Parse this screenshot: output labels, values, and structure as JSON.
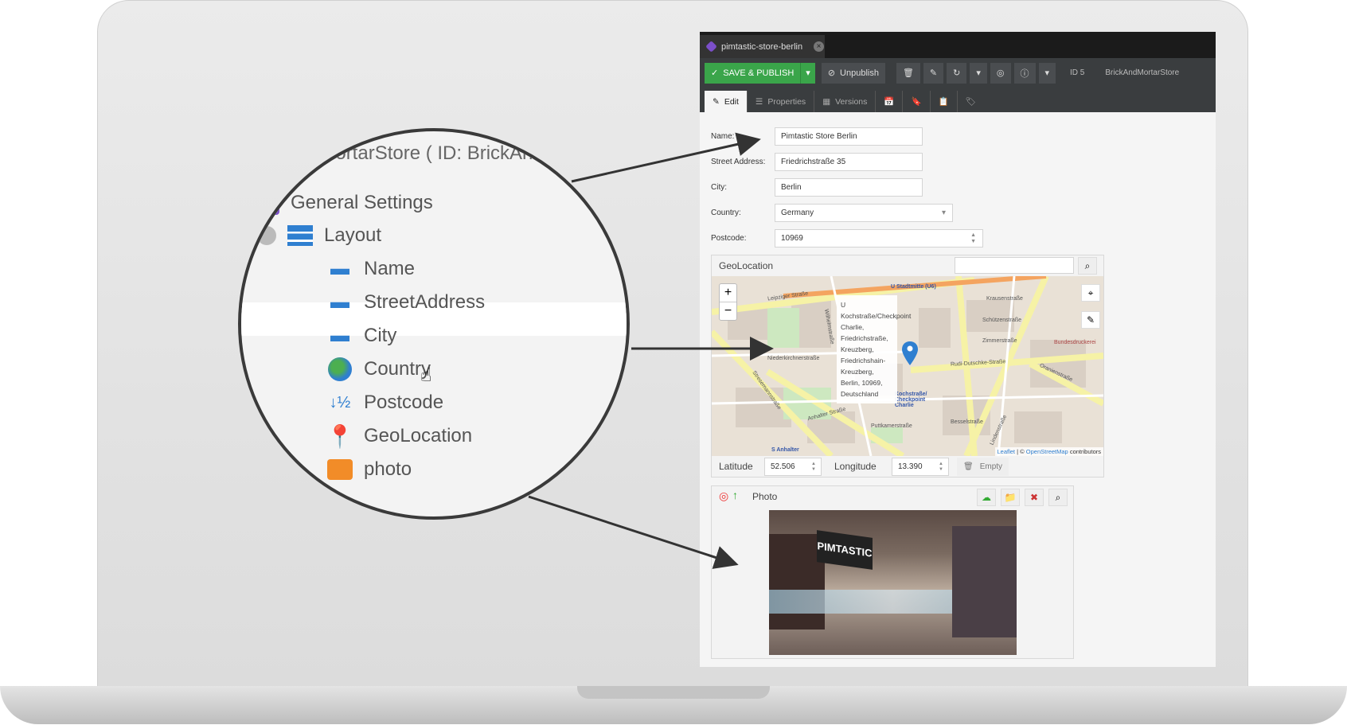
{
  "tab": {
    "title": "pimtastic-store-berlin"
  },
  "toolbar": {
    "save_publish": "SAVE & PUBLISH",
    "unpublish": "Unpublish",
    "id": "ID 5",
    "class_name": "BrickAndMortarStore"
  },
  "subtabs": [
    "Edit",
    "Properties",
    "Versions"
  ],
  "form": {
    "name": {
      "label": "Name:",
      "value": "Pimtastic Store Berlin"
    },
    "street": {
      "label": "Street Address:",
      "value": "Friedrichstraße 35"
    },
    "city": {
      "label": "City:",
      "value": "Berlin"
    },
    "country": {
      "label": "Country:",
      "value": "Germany"
    },
    "postcode": {
      "label": "Postcode:",
      "value": "10969"
    }
  },
  "geo": {
    "title": "GeoLocation",
    "latitude_label": "Latitude",
    "latitude": "52.506",
    "longitude_label": "Longitude",
    "longitude": "13.390",
    "empty": "Empty",
    "popup": [
      "U",
      "Kochstraße/Checkpoint",
      "Charlie,",
      "Friedrichstraße,",
      "Kreuzberg,",
      "Friedrichshain-",
      "Kreuzberg,",
      "Berlin, 10969,",
      "Deutschland"
    ],
    "attribution_leaflet": "Leaflet",
    "attribution_osm": "OpenStreetMap",
    "attribution_rest": "contributors",
    "streets": [
      "Leipziger Straße",
      "U Stadtmitte (U6)",
      "Krausenstraße",
      "Schützenstraße",
      "Zimmerstraße",
      "Rudi-Dutschke-Straße",
      "Oranienstraße",
      "Niederkirchnerstraße",
      "Stresemannstraße",
      "Anhalter Straße",
      "Wilhelmstraße",
      "Kochstraße/ Checkpoint Charlie",
      "Bundesdruckerei",
      "S Anhalter",
      "Lindenstraße",
      "Puttkamerstraße",
      "Besselstraße"
    ]
  },
  "photo": {
    "title": "Photo",
    "sign": "PIMTASTIC"
  },
  "zoom": {
    "header": "dMortarStore ( ID: BrickAnd",
    "tree": [
      {
        "label": "General Settings"
      },
      {
        "label": "Layout"
      },
      {
        "label": "Name"
      },
      {
        "label": "StreetAddress"
      },
      {
        "label": "City"
      },
      {
        "label": "Country"
      },
      {
        "label": "Postcode"
      },
      {
        "label": "GeoLocation"
      },
      {
        "label": "photo"
      }
    ]
  },
  "colors": {
    "green": "#3aa54a",
    "dark": "#3a3d3f",
    "accent": "#7b4fc9"
  }
}
